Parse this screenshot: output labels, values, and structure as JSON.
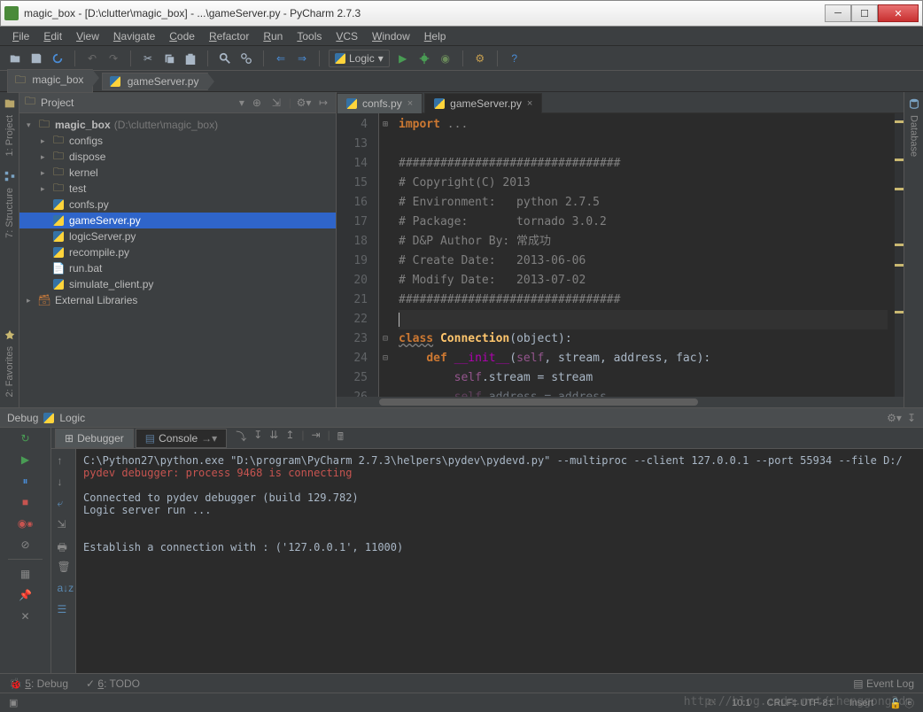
{
  "window": {
    "title": "magic_box - [D:\\clutter\\magic_box] - ...\\gameServer.py - PyCharm 2.7.3"
  },
  "menu": [
    "File",
    "Edit",
    "View",
    "Navigate",
    "Code",
    "Refactor",
    "Run",
    "Tools",
    "VCS",
    "Window",
    "Help"
  ],
  "run_config": "Logic",
  "breadcrumb": [
    {
      "label": "magic_box",
      "icon": "folder"
    },
    {
      "label": "gameServer.py",
      "icon": "python"
    }
  ],
  "project_panel": {
    "title": "Project",
    "root": {
      "name": "magic_box",
      "path": "(D:\\clutter\\magic_box)"
    },
    "folders": [
      "configs",
      "dispose",
      "kernel",
      "test"
    ],
    "files": [
      "confs.py",
      "gameServer.py",
      "logicServer.py",
      "recompile.py",
      "run.bat",
      "simulate_client.py"
    ],
    "selected": "gameServer.py",
    "external": "External Libraries"
  },
  "editor_tabs": [
    {
      "name": "confs.py",
      "active": false
    },
    {
      "name": "gameServer.py",
      "active": true
    }
  ],
  "code": {
    "lines": [
      {
        "n": 4,
        "t": "import ...",
        "type": "import",
        "fold": "+"
      },
      {
        "n": 13,
        "t": "",
        "type": "blank"
      },
      {
        "n": 14,
        "t": "################################",
        "type": "comment"
      },
      {
        "n": 15,
        "t": "# Copyright(C) 2013",
        "type": "comment"
      },
      {
        "n": 16,
        "t": "# Environment:   python 2.7.5",
        "type": "comment"
      },
      {
        "n": 17,
        "t": "# Package:       tornado 3.0.2",
        "type": "comment"
      },
      {
        "n": 18,
        "t": "# D&P Author By: 常成功",
        "type": "comment"
      },
      {
        "n": 19,
        "t": "# Create Date:   2013-06-06",
        "type": "comment"
      },
      {
        "n": 20,
        "t": "# Modify Date:   2013-07-02",
        "type": "comment"
      },
      {
        "n": 21,
        "t": "################################",
        "type": "comment"
      },
      {
        "n": 22,
        "t": "",
        "type": "current"
      },
      {
        "n": 23,
        "t": "class Connection(object):",
        "type": "class",
        "fold": "-"
      },
      {
        "n": 24,
        "t": "    def __init__(self, stream, address, fac):",
        "type": "def",
        "fold": "-"
      },
      {
        "n": 25,
        "t": "        self.stream = stream",
        "type": "body"
      },
      {
        "n": 26,
        "t": "        self.address = address",
        "type": "body-dim"
      }
    ]
  },
  "debug": {
    "title": "Debug",
    "config": "Logic",
    "tabs": [
      "Debugger",
      "Console"
    ],
    "active_tab": "Console",
    "output": [
      {
        "text": "C:\\Python27\\python.exe \"D:\\program\\PyCharm 2.7.3\\helpers\\pydev\\pydevd.py\" --multiproc --client 127.0.0.1 --port 55934 --file D:/",
        "cls": ""
      },
      {
        "text": "pydev debugger: process 9468 is connecting",
        "cls": "red"
      },
      {
        "text": "",
        "cls": ""
      },
      {
        "text": "Connected to pydev debugger (build 129.782)",
        "cls": ""
      },
      {
        "text": "Logic server run ...",
        "cls": ""
      },
      {
        "text": "",
        "cls": ""
      },
      {
        "text": "",
        "cls": ""
      },
      {
        "text": "Establish a connection with : ('127.0.0.1', 11000)",
        "cls": ""
      }
    ]
  },
  "left_tools": [
    {
      "label": "1: Project",
      "icon": "project"
    },
    {
      "label": "7: Structure",
      "icon": "structure"
    },
    {
      "label": "2: Favorites",
      "icon": "favorites"
    }
  ],
  "right_tools": [
    {
      "label": "Database",
      "icon": "database"
    }
  ],
  "bottom_tools": {
    "left": [
      {
        "label": "5: Debug",
        "icon": "bug",
        "underline": "5"
      },
      {
        "label": "6: TODO",
        "icon": "todo",
        "underline": "6"
      }
    ],
    "right": {
      "label": "Event Log",
      "icon": "log"
    }
  },
  "status": {
    "pos": "10:1",
    "enc": "CRLF‡  UTF-8‡",
    "ins": "Insert",
    "lock": "🔓 ⓔ"
  },
  "watermark": "http://blog.csdn.net/chenggong2dm"
}
